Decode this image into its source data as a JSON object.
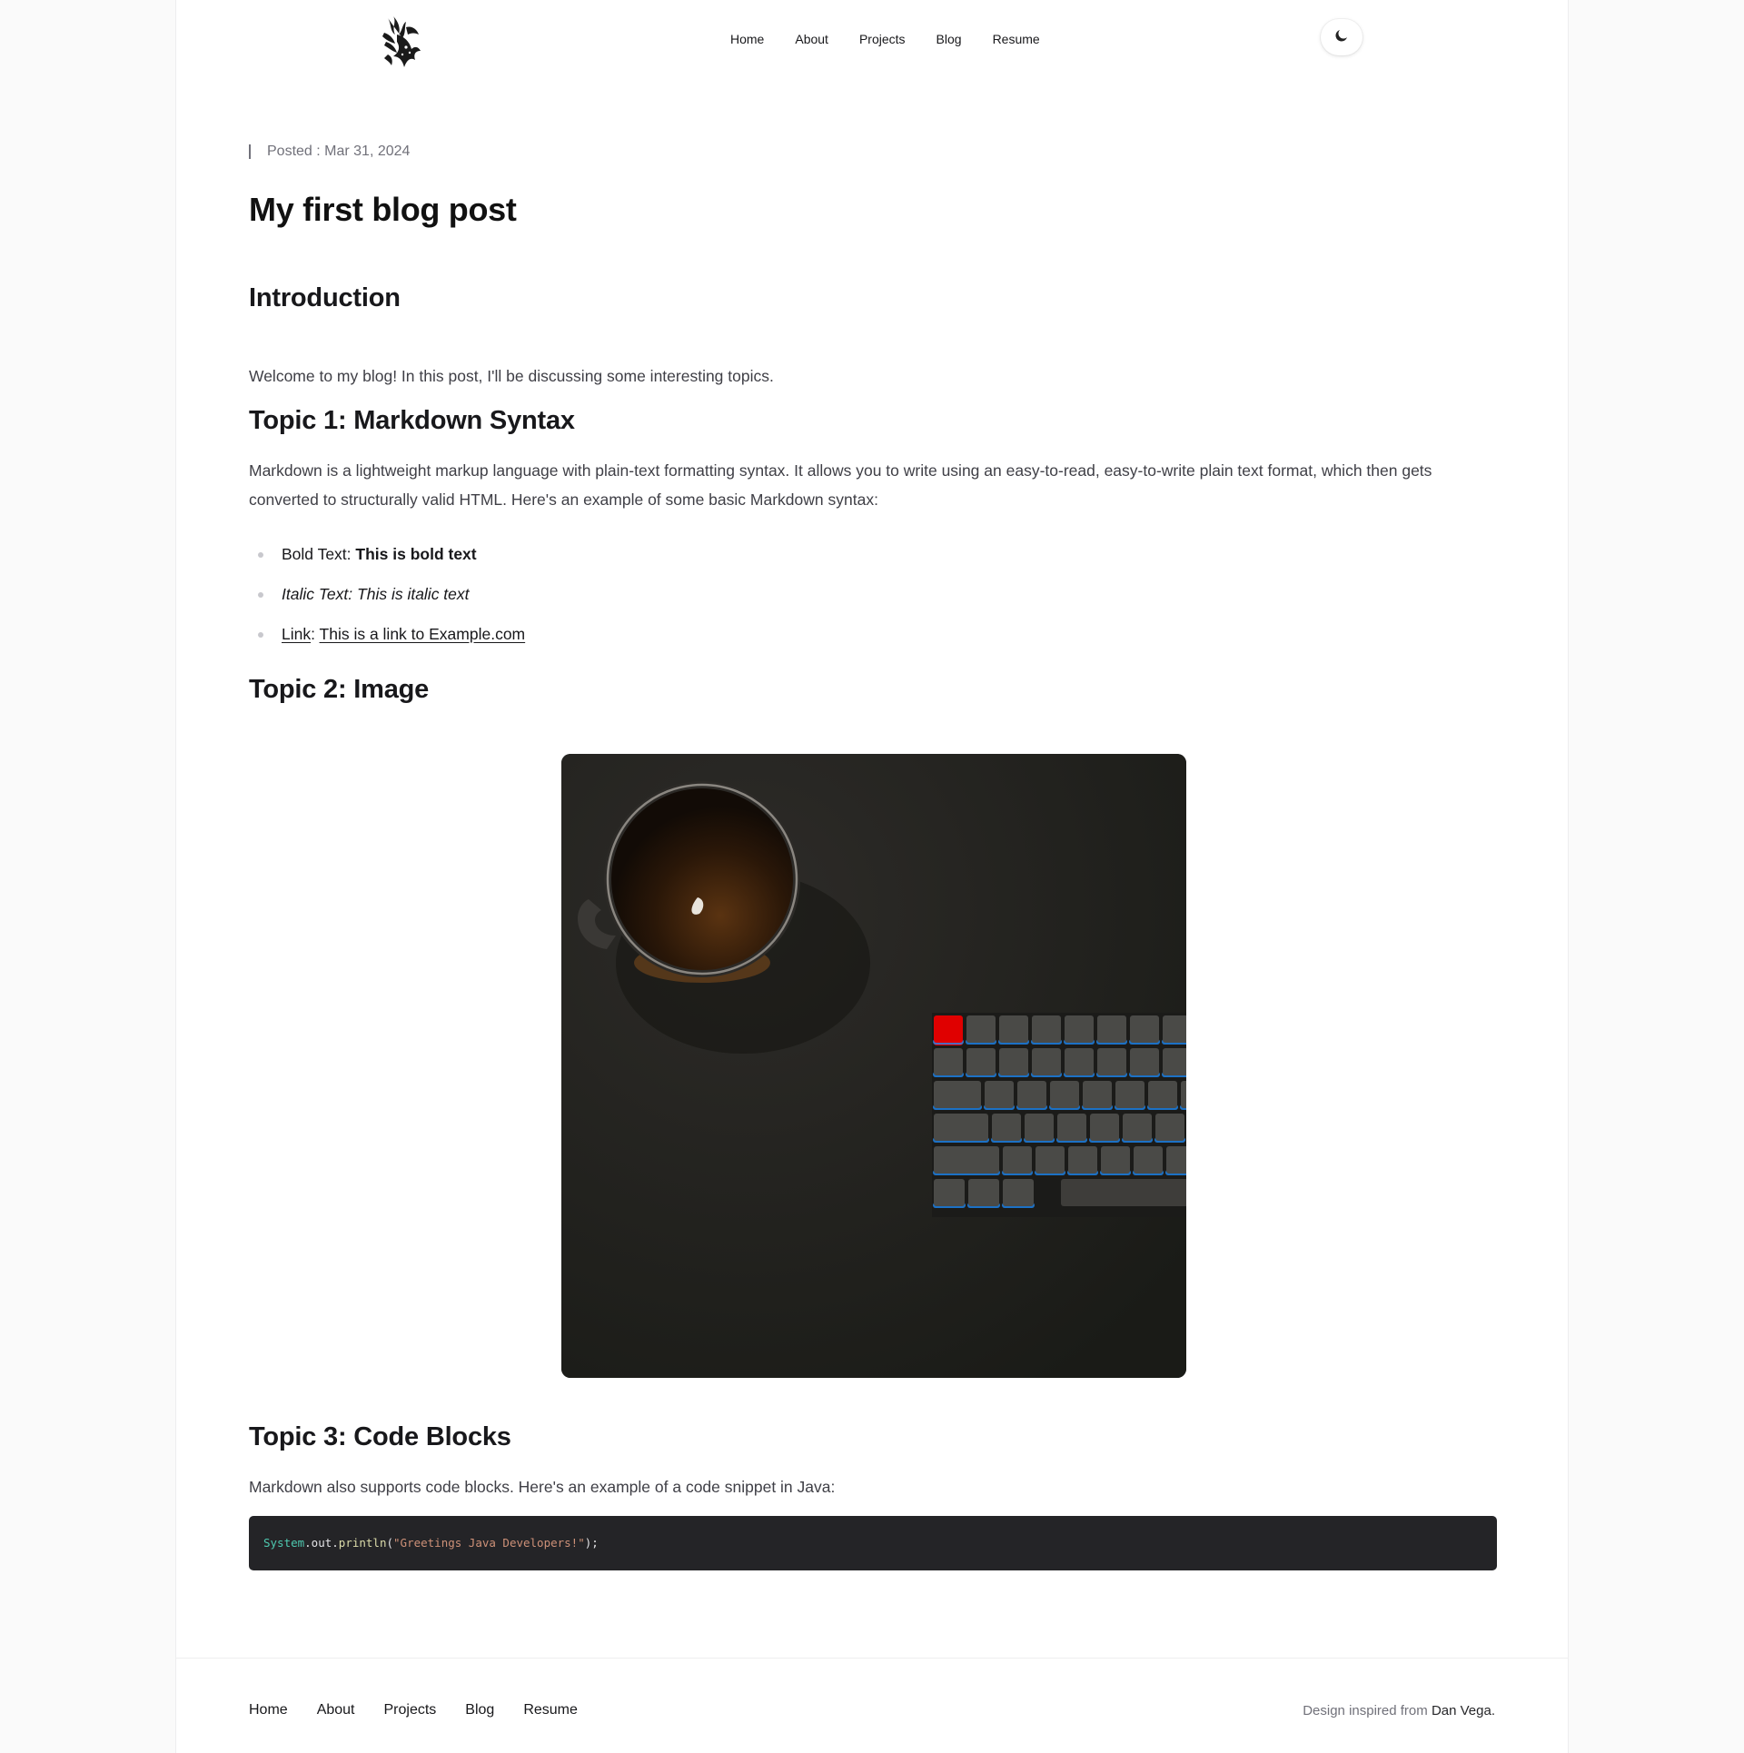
{
  "header": {
    "logo_name": "phoenix-logo",
    "nav": [
      "Home",
      "About",
      "Projects",
      "Blog",
      "Resume"
    ],
    "theme_icon": "moon-icon"
  },
  "post": {
    "posted_label": "Posted : Mar 31, 2024",
    "title": "My first blog post",
    "intro_heading": "Introduction",
    "intro_text": "Welcome to my blog! In this post, I'll be discussing some interesting topics.",
    "topic1_heading": "Topic 1: Markdown Syntax",
    "topic1_text": "Markdown is a lightweight markup language with plain-text formatting syntax. It allows you to write using an easy-to-read, easy-to-write plain text format, which then gets converted to structurally valid HTML. Here's an example of some basic Markdown syntax:",
    "list": {
      "bold_label": "Bold Text",
      "bold_value": "This is bold text",
      "italic_label": "Italic Text",
      "italic_value": "This is italic text",
      "link_label": "Link",
      "link_value": "This is a link to Example.com"
    },
    "topic2_heading": "Topic 2: Image",
    "topic3_heading": "Topic 3: Code Blocks",
    "topic3_text": "Markdown also supports code blocks. Here's an example of a code snippet in Java:",
    "code": {
      "class": "System",
      "member": ".out.",
      "method": "println",
      "open": "(",
      "string": "\"Greetings Java Developers!\"",
      "close": ");"
    }
  },
  "footer": {
    "nav": [
      "Home",
      "About",
      "Projects",
      "Blog",
      "Resume"
    ],
    "credit_prefix": "Design inspired from",
    "credit_name": "Dan Vega."
  },
  "colors": {
    "background": "#fafafa",
    "code_bg": "#242427",
    "keyboard_accent": "#e00000",
    "keyboard_glow": "#1e90ff"
  }
}
